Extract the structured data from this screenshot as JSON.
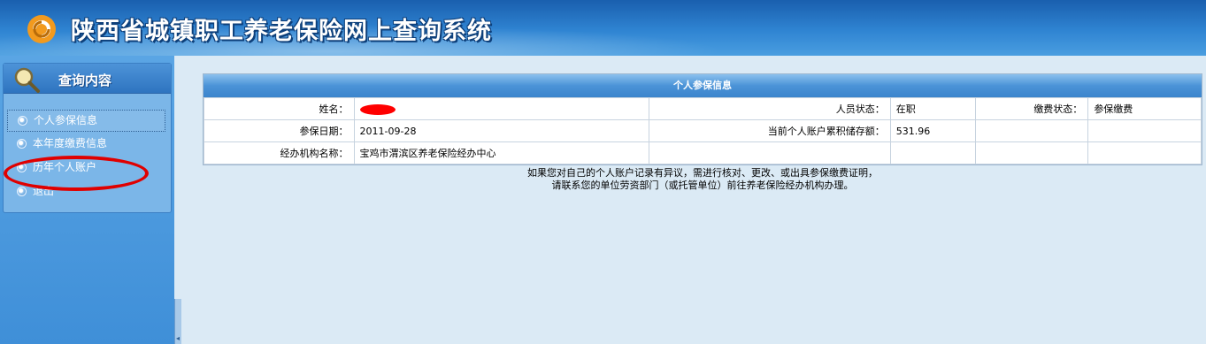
{
  "header": {
    "title": "陕西省城镇职工养老保险网上查询系统"
  },
  "sidebar": {
    "title": "查询内容",
    "items": [
      {
        "label": "个人参保信息",
        "selected": true
      },
      {
        "label": "本年度缴费信息",
        "selected": false
      },
      {
        "label": "历年个人账户",
        "selected": false
      },
      {
        "label": "退出",
        "selected": false
      }
    ],
    "splitter_arrow": "◂"
  },
  "table": {
    "caption": "个人参保信息",
    "row1": {
      "name_label": "姓名：",
      "name_value": "",
      "status_label": "人员状态：",
      "status_value": "在职",
      "pay_status_label": "缴费状态：",
      "pay_status_value": "参保缴费"
    },
    "row2": {
      "date_label": "参保日期：",
      "date_value": "2011-09-28",
      "balance_label": "当前个人账户累积储存额：",
      "balance_value": "531.96"
    },
    "row3": {
      "agency_label": "经办机构名称：",
      "agency_value": "宝鸡市渭滨区养老保险经办中心"
    }
  },
  "notice": {
    "line1": "如果您对自己的个人账户记录有异议，需进行核对、更改、或出具参保缴费证明，",
    "line2": "请联系您的单位劳资部门（或托管单位）前往养老保险经办机构办理。"
  },
  "colors": {
    "header": "#2f84d2",
    "sidebar": "#4a9ae0",
    "annotation": "#e00000"
  }
}
